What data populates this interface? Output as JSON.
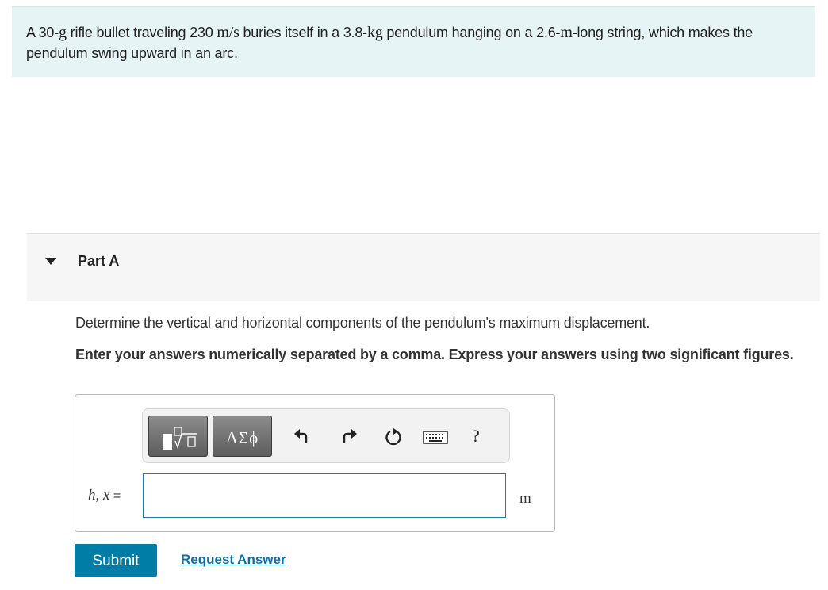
{
  "problem": {
    "seg1": "A 30-",
    "unit_g": "g",
    "seg2": " rifle bullet traveling 230 ",
    "unit_ms": "m/s",
    "seg3": " buries itself in a 3.8-",
    "unit_kg": "kg",
    "seg4": " pendulum hanging on a 2.6-",
    "unit_m": "m",
    "seg5": "-long string, which makes the pendulum swing upward in an arc."
  },
  "part": {
    "title": "Part A",
    "question": "Determine the vertical and horizontal components of the pendulum's maximum displacement.",
    "instructions": "Enter your answers numerically separated by a comma. Express your answers using two significant figures."
  },
  "answer": {
    "variable": "h, x",
    "equals": " =",
    "value": "",
    "unit": "m"
  },
  "toolbar": {
    "greek_label": "ΑΣϕ",
    "help_label": "?",
    "icons": [
      "templates-icon",
      "undo-icon",
      "redo-icon",
      "reset-icon",
      "keyboard-icon",
      "help-icon"
    ]
  },
  "actions": {
    "submit_label": "Submit",
    "request_label": "Request Answer"
  },
  "colors": {
    "problem_bg": "#e6f4f5",
    "accent": "#007da7",
    "link": "#0b6fa4"
  }
}
